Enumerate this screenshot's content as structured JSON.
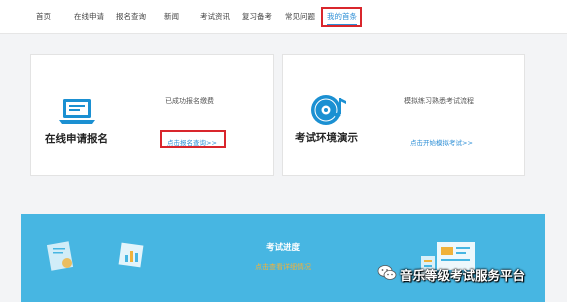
{
  "nav": {
    "items": [
      "首页",
      "在线申请",
      "报名查询",
      "新闻",
      "考试资讯",
      "复习备考",
      "常见问题",
      "我的首条"
    ],
    "active_index": 7
  },
  "cards": [
    {
      "title": "在线申请报名",
      "desc": "已成功报名缴费",
      "link": "点击报名查询>>",
      "icon": "laptop-icon"
    },
    {
      "title": "考试环境演示",
      "desc": "模拟练习熟悉考试流程",
      "link": "点击开始模拟考试>>",
      "icon": "music-disc-icon"
    }
  ],
  "progress": {
    "title": "考试进度",
    "link": "点击查看详细情况"
  },
  "watermark": {
    "text": "音乐等级考试服务平台",
    "icon": "wechat-icon"
  },
  "colors": {
    "accent": "#2e8fd6",
    "highlight": "#d9262c",
    "banner": "#47b6e2"
  }
}
